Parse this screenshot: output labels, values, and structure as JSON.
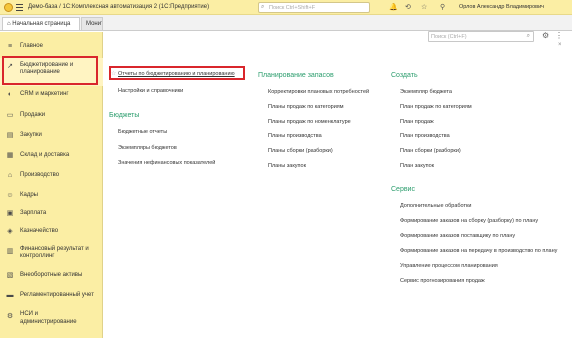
{
  "window": {
    "title": "Демо-база / 1С:Комплексная автоматизация 2  (1С:Предприятие)",
    "search_placeholder": "Поиск Ctrl+Shift+F",
    "user": "Орлов Александр Владимирович"
  },
  "tabs": [
    {
      "label": "Начальная страница"
    },
    {
      "label": "Монит"
    }
  ],
  "sidebar": {
    "items": [
      {
        "label": "Главное",
        "icon": "menu-icon"
      },
      {
        "label": "Бюджетирование и",
        "label2": "планирование",
        "icon": "chart-icon"
      },
      {
        "label": "CRM и маркетинг",
        "icon": "crm-icon"
      },
      {
        "label": "Продажи",
        "icon": "sales-icon"
      },
      {
        "label": "Закупки",
        "icon": "purchases-icon"
      },
      {
        "label": "Склад и доставка",
        "icon": "warehouse-icon"
      },
      {
        "label": "Производство",
        "icon": "factory-icon"
      },
      {
        "label": "Кадры",
        "icon": "people-icon"
      },
      {
        "label": "Зарплата",
        "icon": "salary-icon"
      },
      {
        "label": "Казначейство",
        "icon": "treasury-icon"
      },
      {
        "label": "Финансовый результат и",
        "label2": "контроллинг",
        "icon": "finance-icon"
      },
      {
        "label": "Внеоборотные активы",
        "icon": "assets-icon"
      },
      {
        "label": "Регламентированный учет",
        "icon": "accounting-icon"
      },
      {
        "label": "НСИ и",
        "label2": "администрирование",
        "icon": "settings-icon"
      }
    ]
  },
  "main": {
    "search_placeholder": "Поиск (Ctrl+F)",
    "col1": {
      "top_links": [
        "Отчеты по бюджетированию и планированию",
        "Настройки и справочники"
      ],
      "section_title": "Бюджеты",
      "links": [
        "Бюджетные отчеты",
        "Экземпляры бюджетов",
        "Значения нефинансовых показателей"
      ]
    },
    "col2": {
      "section_title": "Планирование запасов",
      "links": [
        "Корректировки плановых потребностей",
        "Планы продаж по категориям",
        "Планы продаж по номенклатуре",
        "Планы производства",
        "Планы сборки (разборки)",
        "Планы закупок"
      ]
    },
    "col3": {
      "section_title": "Создать",
      "links": [
        "Экземпляр бюджета",
        "План продаж по категориям",
        "План продаж",
        "План производства",
        "План сборки (разборки)",
        "План закупок"
      ],
      "section2_title": "Сервис",
      "links2": [
        "Дополнительные обработки",
        "Формирование заказов на сборку (разборку) по плану",
        "Формирование заказов поставщику по плану",
        "Формирование заказов на передачу в производство по плану",
        "Управление процессом планирования",
        "Сервис прогнозирования продаж"
      ]
    }
  },
  "colors": {
    "sidebar_bg": "#fbeea4",
    "heading": "#2b9d6d",
    "highlight": "#d9262c"
  }
}
